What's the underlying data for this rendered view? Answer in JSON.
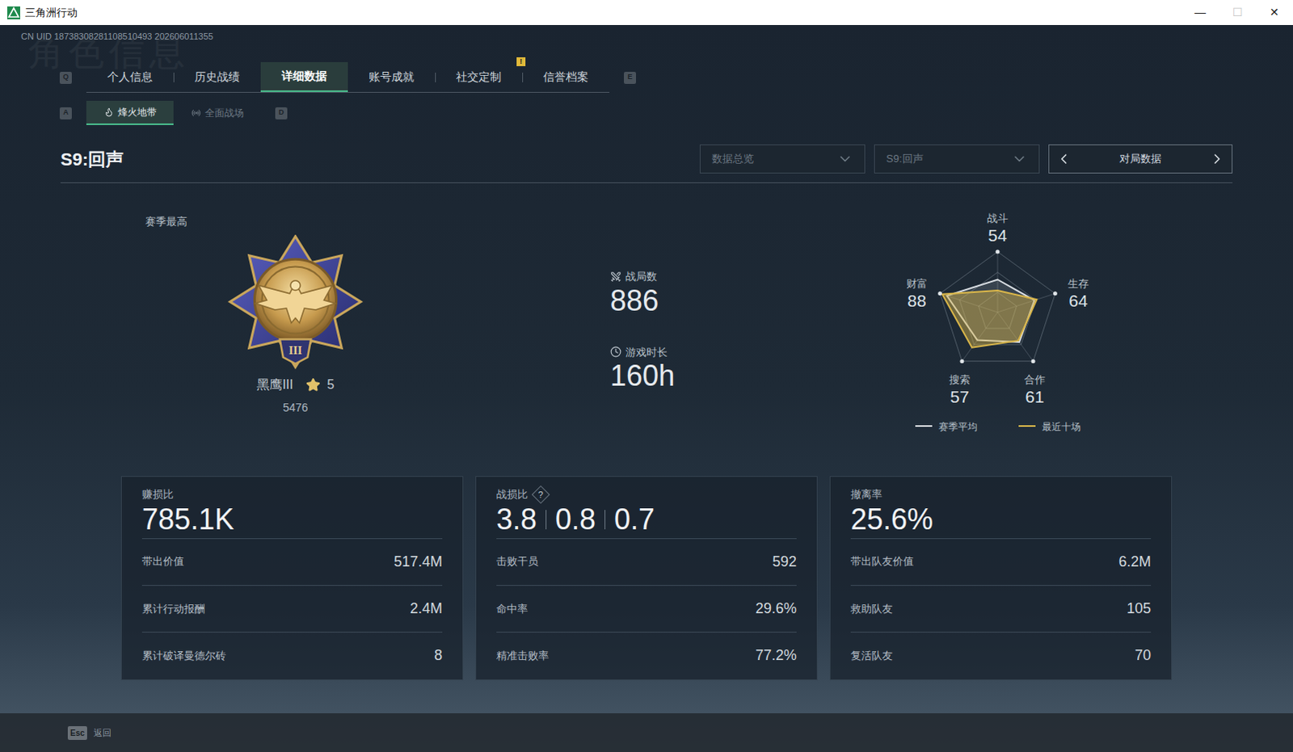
{
  "window": {
    "title": "三角洲行动",
    "controls": [
      {
        "glyph": "—",
        "disabled": false
      },
      {
        "glyph": "☐",
        "disabled": true
      },
      {
        "glyph": "✕",
        "disabled": false
      }
    ]
  },
  "uid": "CN UID 18738308281108510493 202606011355",
  "watermark": "角色信息",
  "tabs": {
    "prev_key": "Q",
    "next_key": "E",
    "items": [
      {
        "label": "个人信息",
        "selected": false
      },
      {
        "label": "历史战绩",
        "selected": false
      },
      {
        "label": "详细数据",
        "selected": true
      },
      {
        "label": "账号成就",
        "selected": false
      },
      {
        "label": "社交定制",
        "selected": false,
        "badge": "!"
      },
      {
        "label": "信誉档案",
        "selected": false
      }
    ]
  },
  "mode_tabs": {
    "prev_key": "A",
    "next_key": "D",
    "items": [
      {
        "label": "烽火地带",
        "selected": true,
        "kind": "flame"
      },
      {
        "label": "全面战场",
        "selected": false,
        "kind": "radio"
      }
    ]
  },
  "season_title": "S9:回声",
  "filters": [
    {
      "value": "数据总览",
      "disabled": true
    },
    {
      "value": "S9:回声",
      "disabled": true
    }
  ],
  "pager": {
    "label": "对局数据"
  },
  "rank": {
    "caption": "赛季最高",
    "name": "黑鹰III",
    "stars": "5",
    "score": "5476",
    "emblem_numeral": "III"
  },
  "summary": [
    {
      "label": "战局数",
      "value": "886",
      "kind": "matches"
    },
    {
      "label": "游戏时长",
      "value": "160h",
      "kind": "time"
    }
  ],
  "radar": {
    "axes": [
      {
        "label": "战斗",
        "value": "54"
      },
      {
        "label": "生存",
        "value": "64"
      },
      {
        "label": "合作",
        "value": "61"
      },
      {
        "label": "搜索",
        "value": "57"
      },
      {
        "label": "财富",
        "value": "88"
      }
    ],
    "series": [
      {
        "name": "赛季平均",
        "color": "#d8dde2",
        "values": [
          54,
          64,
          61,
          57,
          88
        ]
      },
      {
        "name": "最近十场",
        "color": "#d9b64a",
        "values": [
          36,
          68,
          58,
          72,
          96
        ]
      }
    ]
  },
  "cards": [
    {
      "title": "赚损比",
      "values": [
        "785.1K"
      ],
      "rows": [
        {
          "label": "带出价值",
          "value": "517.4M"
        },
        {
          "label": "累计行动报酬",
          "value": "2.4M"
        },
        {
          "label": "累计破译曼德尔砖",
          "value": "8"
        }
      ]
    },
    {
      "title": "战损比",
      "help": "?",
      "values": [
        "3.8",
        "0.8",
        "0.7"
      ],
      "rows": [
        {
          "label": "击败干员",
          "value": "592"
        },
        {
          "label": "命中率",
          "value": "29.6%"
        },
        {
          "label": "精准击败率",
          "value": "77.2%"
        }
      ]
    },
    {
      "title": "撤离率",
      "values": [
        "25.6%"
      ],
      "rows": [
        {
          "label": "带出队友价值",
          "value": "6.2M"
        },
        {
          "label": "救助队友",
          "value": "105"
        },
        {
          "label": "复活队友",
          "value": "70"
        }
      ]
    }
  ],
  "footer": {
    "key": "Esc",
    "label": "返回"
  }
}
